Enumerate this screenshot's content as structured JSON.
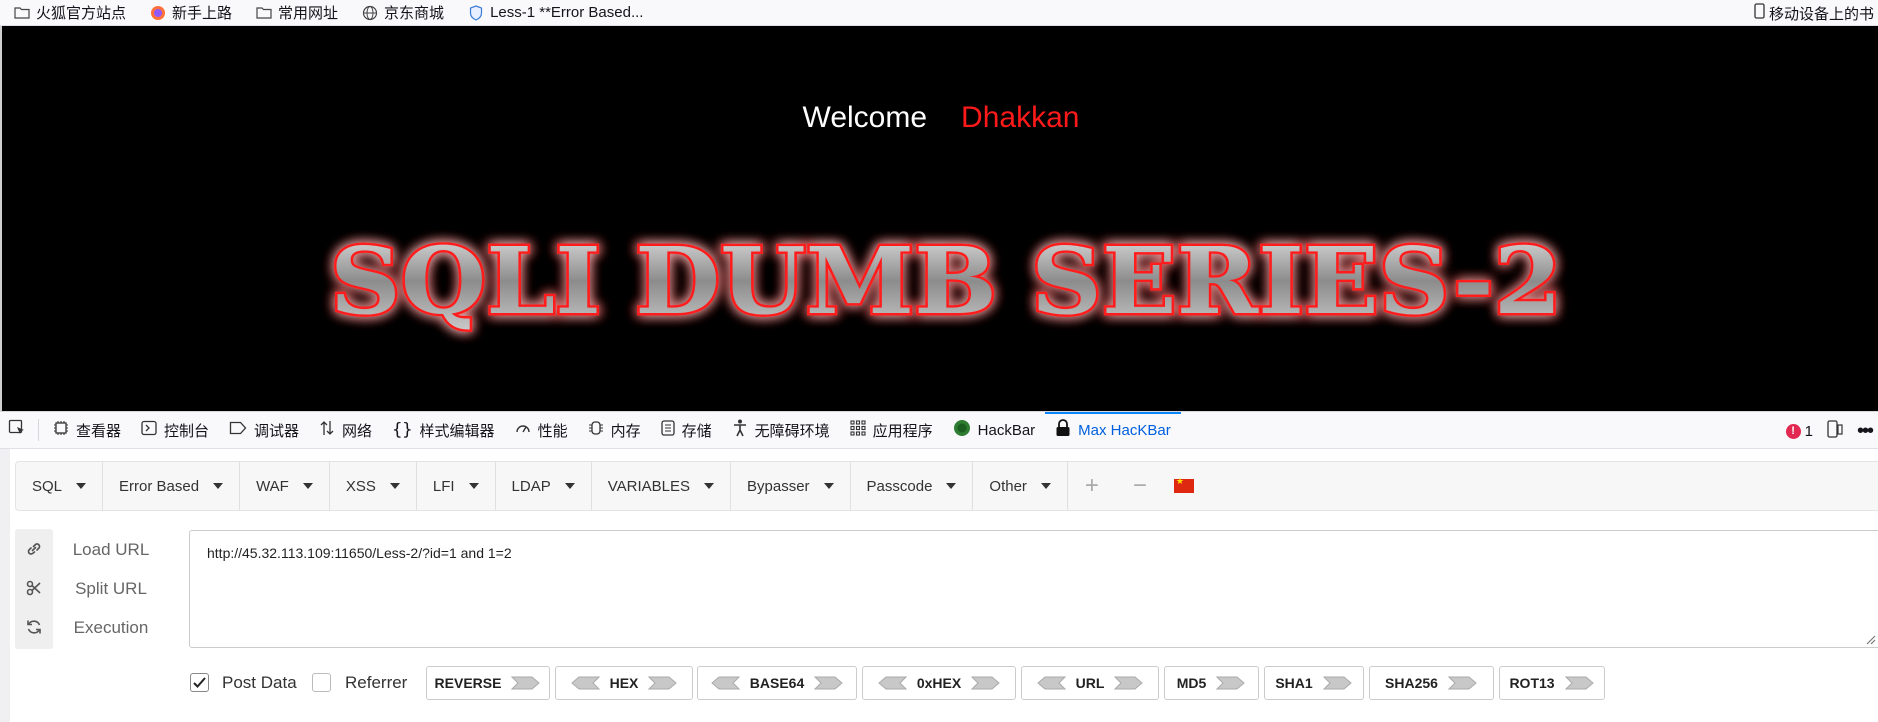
{
  "bookmarks": {
    "items": [
      {
        "label": "火狐官方站点",
        "icon": "folder-icon"
      },
      {
        "label": "新手上路",
        "icon": "firefox-icon"
      },
      {
        "label": "常用网址",
        "icon": "folder-icon"
      },
      {
        "label": "京东商城",
        "icon": "globe-icon"
      },
      {
        "label": "Less-1 **Error Based...",
        "icon": "shield-icon"
      }
    ],
    "right_label": "移动设备上的书"
  },
  "page": {
    "welcome": "Welcome",
    "name": "Dhakkan",
    "banner": "SQLI DUMB SERIES-2"
  },
  "devtools": {
    "tabs": [
      {
        "label": "查看器",
        "icon": "inspector-icon"
      },
      {
        "label": "控制台",
        "icon": "console-icon"
      },
      {
        "label": "调试器",
        "icon": "debugger-icon"
      },
      {
        "label": "网络",
        "icon": "network-icon"
      },
      {
        "label": "样式编辑器",
        "icon": "braces-icon"
      },
      {
        "label": "性能",
        "icon": "gauge-icon"
      },
      {
        "label": "内存",
        "icon": "memory-icon"
      },
      {
        "label": "存储",
        "icon": "storage-icon"
      },
      {
        "label": "无障碍环境",
        "icon": "accessibility-icon"
      },
      {
        "label": "应用程序",
        "icon": "grid-icon"
      },
      {
        "label": "HackBar",
        "icon": "hackbar-icon"
      },
      {
        "label": "Max HacKBar",
        "icon": "lock-icon"
      }
    ],
    "error_count": "1"
  },
  "hackbar": {
    "menu": [
      "SQL",
      "Error Based",
      "WAF",
      "XSS",
      "LFI",
      "LDAP",
      "VARIABLES",
      "Bypasser",
      "Passcode",
      "Other"
    ],
    "actions": [
      "Load URL",
      "Split URL",
      "Execution"
    ],
    "url": "http://45.32.113.109:11650/Less-2/?id=1 and 1=2",
    "post_data_label": "Post Data",
    "referrer_label": "Referrer",
    "post_data_checked": true,
    "referrer_checked": false,
    "encoders": [
      "REVERSE",
      "HEX",
      "BASE64",
      "0xHEX",
      "URL",
      "MD5",
      "SHA1",
      "SHA256",
      "ROT13"
    ]
  }
}
